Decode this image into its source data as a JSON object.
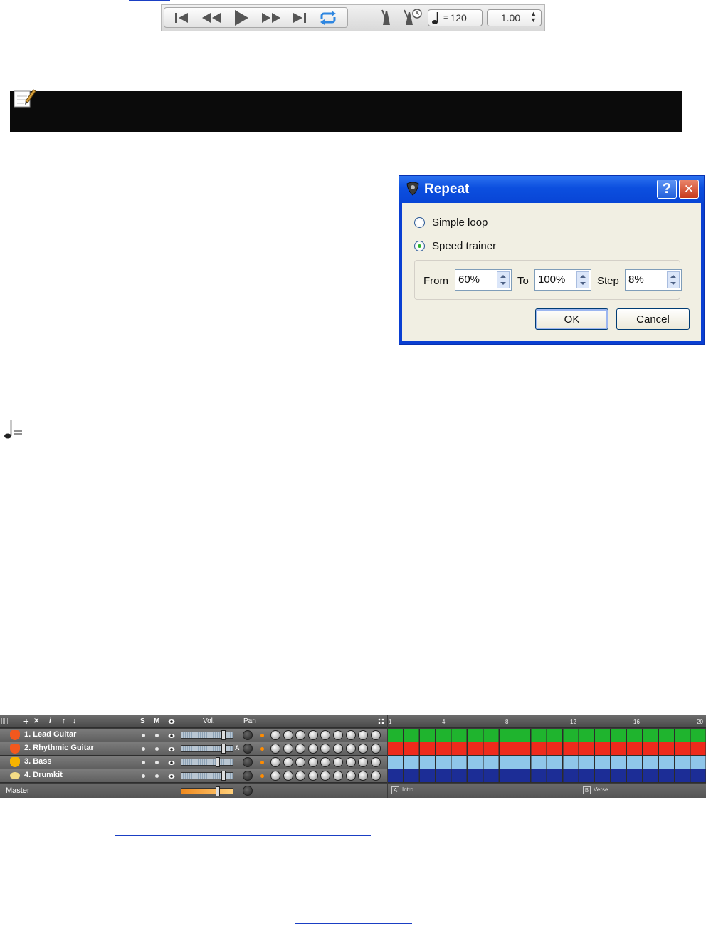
{
  "transport": {
    "buttons": [
      {
        "icon": "skip-to-start-icon"
      },
      {
        "icon": "rewind-icon"
      },
      {
        "icon": "play-icon"
      },
      {
        "icon": "fast-forward-icon"
      },
      {
        "icon": "skip-to-end-icon"
      },
      {
        "icon": "loop-icon"
      }
    ],
    "metronome_icon": "metronome-icon",
    "countdown_icon": "metronome-countdown-icon",
    "tempo_value": "120",
    "tempo_equals": "=",
    "speed_value": "1.00"
  },
  "note_bar": {
    "icon": "note-pencil-icon"
  },
  "dialog": {
    "title": "Repeat",
    "help_label": "?",
    "close_label": "✕",
    "simple_loop_label": "Simple loop",
    "speed_trainer_label": "Speed trainer",
    "selected_option": "speed_trainer",
    "from_label": "From",
    "from_value": "60%",
    "to_label": "To",
    "to_value": "100%",
    "step_label": "Step",
    "step_value": "8%",
    "ok_label": "OK",
    "cancel_label": "Cancel"
  },
  "tempo_note_icon": "quarter-note-tempo-icon",
  "mixer": {
    "toolbar": {
      "add": "+",
      "remove": "✕",
      "info": "i",
      "up": "↑",
      "down": "↓"
    },
    "col_solo": "S",
    "col_mute": "M",
    "col_visible_icon": "eye-icon",
    "col_vol": "Vol.",
    "col_pan": "Pan",
    "ruler": [
      "1",
      "4",
      "8",
      "12",
      "16",
      "20"
    ],
    "tracks": [
      {
        "name": "1. Lead Guitar",
        "color": "#1fb42e",
        "icon": "electric-guitar-icon",
        "badge": ""
      },
      {
        "name": "2. Rhythmic Guitar",
        "color": "#ee2a1c",
        "icon": "electric-guitar-icon",
        "badge": "A"
      },
      {
        "name": "3. Bass",
        "color": "#8fc6ea",
        "icon": "bass-icon",
        "badge": ""
      },
      {
        "name": "4. Drumkit",
        "color": "#1c2d96",
        "icon": "drumkit-icon",
        "badge": ""
      }
    ],
    "master_label": "Master",
    "sections": [
      {
        "letter": "A",
        "name": "Intro"
      },
      {
        "letter": "B",
        "name": "Verse"
      }
    ]
  }
}
